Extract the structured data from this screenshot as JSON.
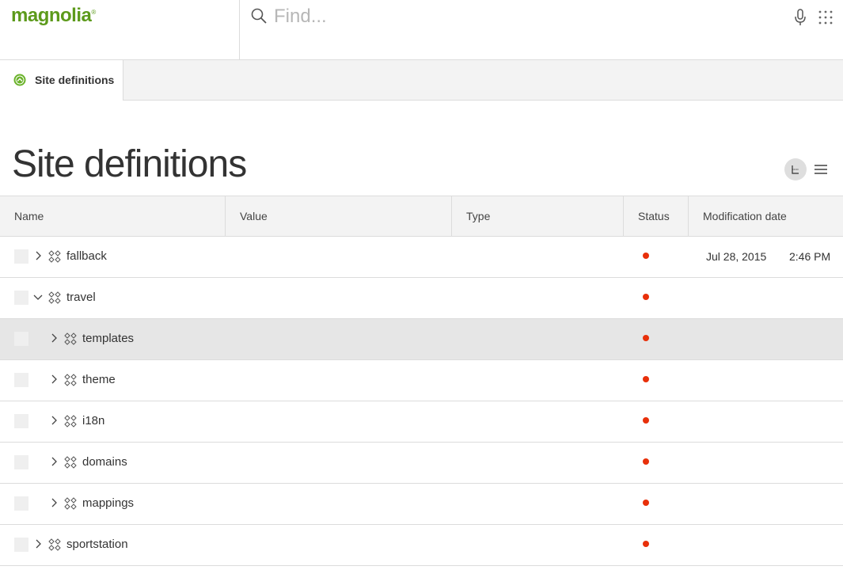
{
  "app": {
    "logo_text": "magnolia",
    "logo_mark": "®"
  },
  "search": {
    "placeholder": "Find..."
  },
  "tabs": [
    {
      "label": "Site definitions",
      "active": true
    }
  ],
  "page": {
    "title": "Site definitions"
  },
  "view_toggle": {
    "tree_view_active": true,
    "icons": [
      "tree-view-icon",
      "list-view-icon"
    ]
  },
  "grid": {
    "columns": [
      {
        "label": "Name"
      },
      {
        "label": "Value"
      },
      {
        "label": "Type"
      },
      {
        "label": "Status"
      },
      {
        "label": "Modification date"
      }
    ],
    "rows": [
      {
        "name": "fallback",
        "level": 0,
        "expanded": false,
        "selected": false,
        "date": "Jul 28, 2015",
        "time": "2:46 PM"
      },
      {
        "name": "travel",
        "level": 0,
        "expanded": true,
        "selected": false,
        "date": "",
        "time": ""
      },
      {
        "name": "templates",
        "level": 1,
        "expanded": false,
        "selected": true,
        "date": "",
        "time": ""
      },
      {
        "name": "theme",
        "level": 1,
        "expanded": false,
        "selected": false,
        "date": "",
        "time": ""
      },
      {
        "name": "i18n",
        "level": 1,
        "expanded": false,
        "selected": false,
        "date": "",
        "time": ""
      },
      {
        "name": "domains",
        "level": 1,
        "expanded": false,
        "selected": false,
        "date": "",
        "time": ""
      },
      {
        "name": "mappings",
        "level": 1,
        "expanded": false,
        "selected": false,
        "date": "",
        "time": ""
      },
      {
        "name": "sportstation",
        "level": 0,
        "expanded": false,
        "selected": false,
        "date": "",
        "time": ""
      }
    ]
  },
  "colors": {
    "brand": "#5c9a1b",
    "status_unpublished": "#e8300a",
    "selected_row": "#e6e6e6"
  }
}
